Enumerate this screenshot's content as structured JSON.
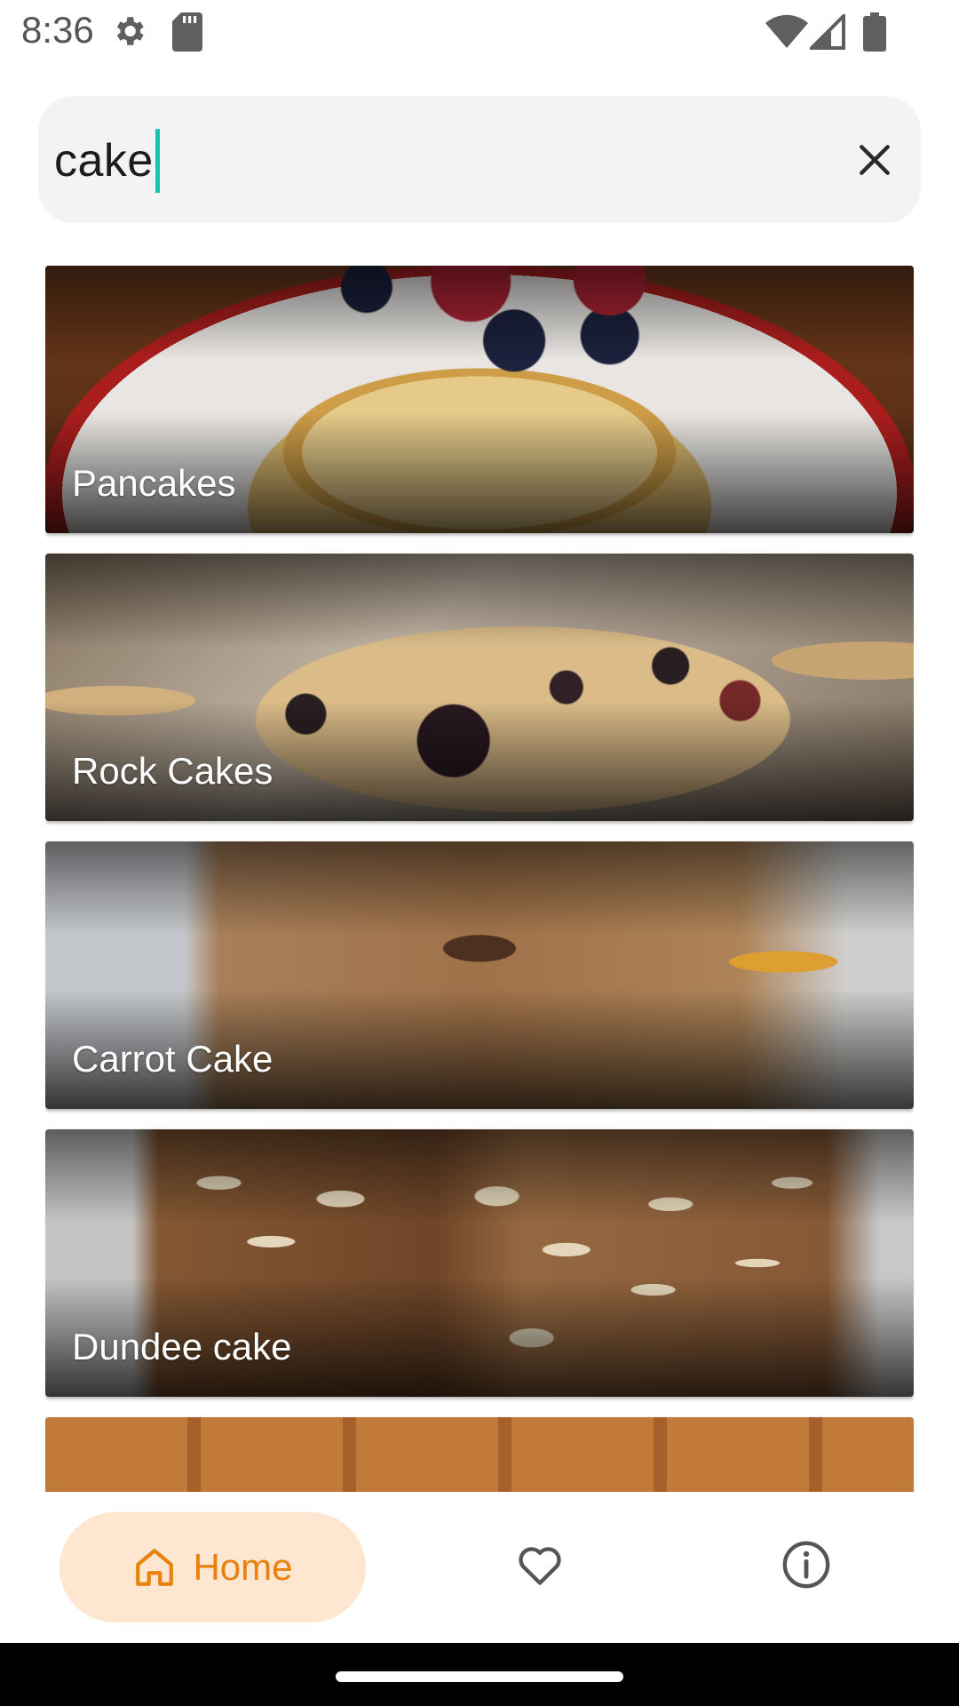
{
  "status_bar": {
    "time": "8:36",
    "icons": [
      "gear-icon",
      "sd-card-icon",
      "wifi-icon",
      "cell-signal-icon",
      "battery-icon"
    ]
  },
  "search": {
    "value": "cake",
    "clear_icon": "close-icon"
  },
  "recipes": [
    {
      "title": "Pancakes"
    },
    {
      "title": "Rock Cakes"
    },
    {
      "title": "Carrot Cake"
    },
    {
      "title": "Dundee cake"
    },
    {
      "title": ""
    }
  ],
  "bottom_nav": {
    "home_label": "Home",
    "items": [
      "home-icon",
      "heart-icon",
      "info-icon"
    ],
    "accent_color": "#e8810d",
    "active_pill_color": "#ffe6d1"
  },
  "colors": {
    "caret": "#19c3b0"
  }
}
